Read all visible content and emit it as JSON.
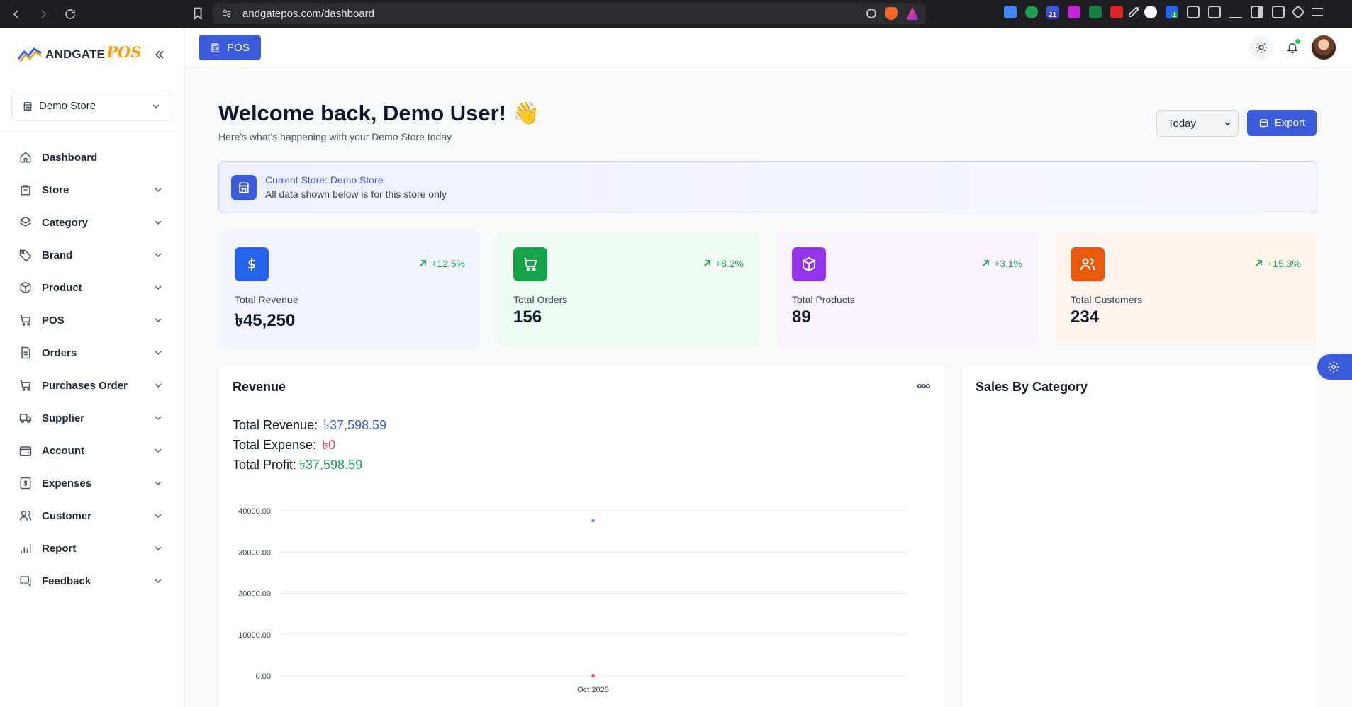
{
  "browser": {
    "url": "andgatepos.com/dashboard",
    "badge_count": "21",
    "ext_badge": "1"
  },
  "sidebar": {
    "logo_text": "ANDGATE",
    "logo_pos": "POS",
    "store_selector": "Demo Store",
    "items": [
      {
        "label": "Dashboard",
        "icon": "home-icon",
        "has_chevron": false
      },
      {
        "label": "Store",
        "icon": "store-icon",
        "has_chevron": true
      },
      {
        "label": "Category",
        "icon": "layers-icon",
        "has_chevron": true
      },
      {
        "label": "Brand",
        "icon": "tag-icon",
        "has_chevron": true
      },
      {
        "label": "Product",
        "icon": "box-icon",
        "has_chevron": true
      },
      {
        "label": "POS",
        "icon": "cart-icon",
        "has_chevron": true
      },
      {
        "label": "Orders",
        "icon": "document-icon",
        "has_chevron": true
      },
      {
        "label": "Purchases Order",
        "icon": "cart-icon",
        "has_chevron": true
      },
      {
        "label": "Supplier",
        "icon": "truck-icon",
        "has_chevron": true
      },
      {
        "label": "Account",
        "icon": "wallet-icon",
        "has_chevron": true
      },
      {
        "label": "Expenses",
        "icon": "receipt-icon",
        "has_chevron": true
      },
      {
        "label": "Customer",
        "icon": "users-icon",
        "has_chevron": true
      },
      {
        "label": "Report",
        "icon": "bar-chart-icon",
        "has_chevron": true
      },
      {
        "label": "Feedback",
        "icon": "message-icon",
        "has_chevron": true
      }
    ]
  },
  "topbar": {
    "pos_label": "POS"
  },
  "header": {
    "welcome": "Welcome back, Demo User! 👋",
    "subtitle": "Here's what's happening with your Demo Store today",
    "range_selected": "Today",
    "export_label": "Export"
  },
  "banner": {
    "title": "Current Store: Demo Store",
    "subtitle": "All data shown below is for this store only"
  },
  "stats": [
    {
      "label": "Total Revenue",
      "value": "৳45,250",
      "trend": "+12.5%",
      "color": "#2563eb",
      "bg": "#f2f5ff",
      "icon": "dollar-icon"
    },
    {
      "label": "Total Orders",
      "value": "156",
      "trend": "+8.2%",
      "color": "#16a34a",
      "bg": "#f0faf3",
      "icon": "cart-icon"
    },
    {
      "label": "Total Products",
      "value": "89",
      "trend": "+3.1%",
      "color": "#9333ea",
      "bg": "#f8f3fe",
      "icon": "box-icon"
    },
    {
      "label": "Total Customers",
      "value": "234",
      "trend": "+15.3%",
      "color": "#ea580c",
      "bg": "#fff5f0",
      "icon": "users-icon"
    }
  ],
  "revenue_panel": {
    "title": "Revenue",
    "total_revenue_label": "Total Revenue:",
    "total_revenue": "৳37,598.59",
    "total_expense_label": "Total Expense:",
    "total_expense": "৳0",
    "total_profit_label": "Total Profit:",
    "total_profit": "৳37,598.59",
    "revenue_color": "#3b5bdb",
    "expense_color": "#ef4444",
    "profit_color": "#16a34a"
  },
  "category_panel": {
    "title": "Sales By Category"
  },
  "chart_data": {
    "type": "scatter",
    "categories": [
      "Oct 2025"
    ],
    "y_ticks": [
      "40000.00",
      "30000.00",
      "20000.00",
      "10000.00",
      "0.00"
    ],
    "ylim": [
      0,
      40000
    ],
    "grid": true,
    "series": [
      {
        "values": [
          37598.59
        ],
        "color": "#3b82f6"
      },
      {
        "values": [
          0
        ],
        "color": "#ef4444"
      }
    ]
  }
}
